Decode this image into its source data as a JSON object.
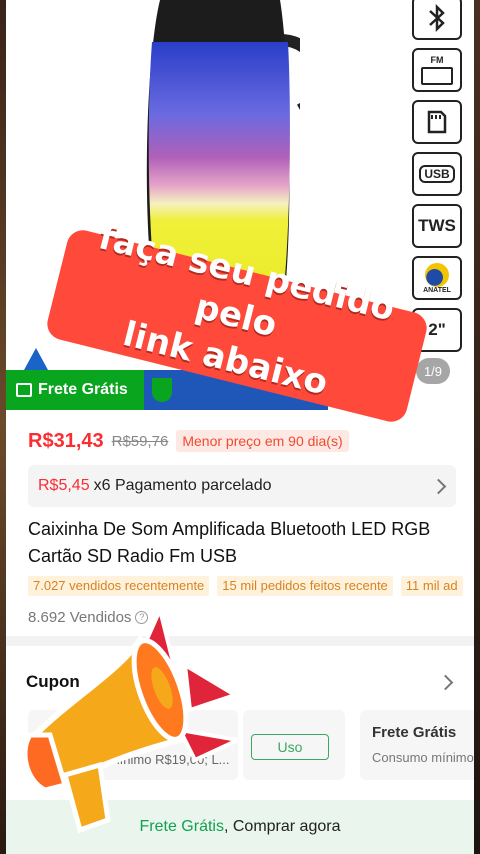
{
  "product_image": {
    "feature_icons": [
      "bluetooth-icon",
      "fm",
      "sd-card-icon",
      "USB",
      "TWS",
      "ANATEL",
      "2\""
    ],
    "fm_label": "FM",
    "usb_label": "USB",
    "tws_label": "TWS",
    "anatel_label": "ANATEL",
    "size_label": "2\"",
    "counter": "1/9"
  },
  "shipping_banner": {
    "label": "Frete Grátis"
  },
  "price": {
    "current": "R$31,43",
    "original": "R$59,76",
    "badge": "Menor preço em 90 dia(s)"
  },
  "installment": {
    "amount": "R$5,45",
    "text": "x6 Pagamento parcelado"
  },
  "product_title": "Caixinha De Som Amplificada Bluetooth LED RGB Cartão SD Radio Fm USB",
  "stats": [
    "7.027 vendidos recentemente",
    "15 mil pedidos feitos recente",
    "11 mil ad"
  ],
  "sold": {
    "text": "8.692 Vendidos",
    "help": "?"
  },
  "coupons": {
    "heading": "Cupon",
    "card1_min": "o mínimo R$19,00; L...",
    "card2_button": "Uso",
    "card3_title": "Frete Grátis",
    "card3_min": "Consumo mínimo"
  },
  "bottom_bar": {
    "highlight": "Frete Grátis",
    "rest": ", Comprar agora"
  },
  "promo_overlay": {
    "line1": "faça seu pedido pelo",
    "line2": "link abaixo"
  },
  "colors": {
    "price_red": "#fa2d32",
    "ship_green": "#0aa51e",
    "promo_red": "#ff4a3b",
    "stat_orange": "#d9821e"
  }
}
